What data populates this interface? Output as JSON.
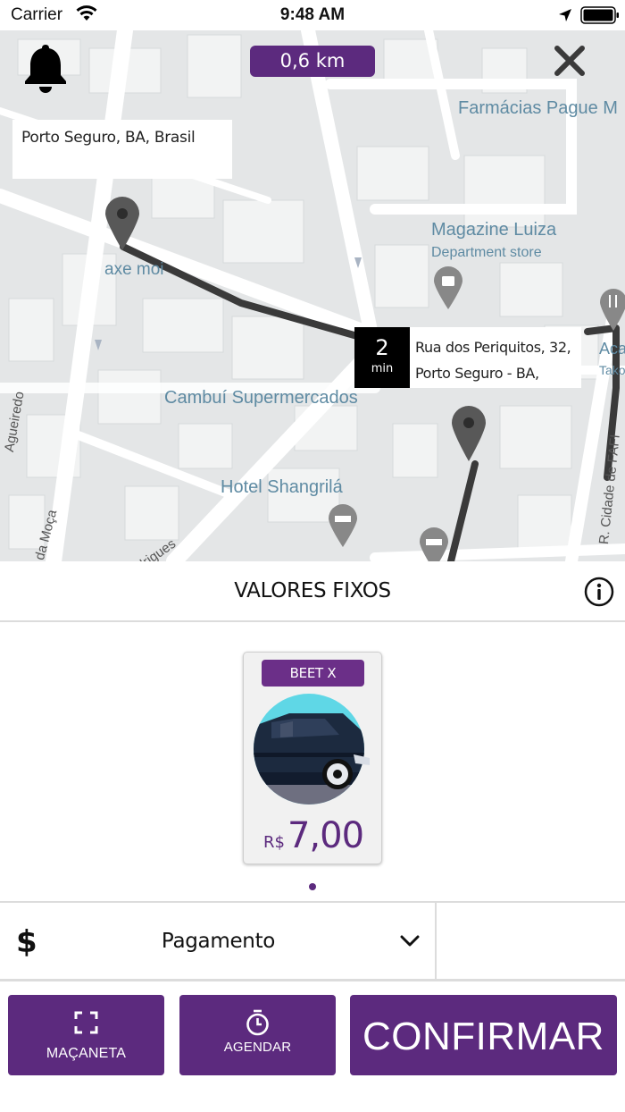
{
  "status_bar": {
    "carrier": "Carrier",
    "time": "9:48 AM",
    "icons": [
      "wifi-icon",
      "location-arrow-icon",
      "battery-icon"
    ]
  },
  "map": {
    "distance": "0,6 km",
    "origin_address": "Porto Seguro, BA, Brasil",
    "eta_value": "2",
    "eta_unit": "min",
    "destination_address_line1": "Rua dos Periquitos, 32,",
    "destination_address_line2": "Porto Seguro - BA,",
    "places": {
      "farmacias": "Farmácias Pague M",
      "magazine": "Magazine Luiza",
      "magazine_sub": "Department store",
      "axe_moi": "axe moi",
      "cambui": "Cambuí Supermercados",
      "hotel": "Hotel Shangrilá",
      "aca": "Aca",
      "tak": "Tako"
    },
    "streets": {
      "left_vertical": "Agueiredo",
      "bottom_moca": "da Moça",
      "bottom_rigues": "drigues",
      "right_vertical": "R. Cidade de FAFI"
    },
    "route_color": "#3a3a3a",
    "accent": "#5c2a7e"
  },
  "fixed_values": {
    "title": "VALORES FIXOS",
    "info_icon": "info-icon"
  },
  "vehicle": {
    "name": "BEET X",
    "currency": "R$",
    "price": "7,00",
    "image_icon": "car-icon"
  },
  "payment": {
    "icon": "dollar-icon",
    "label": "Pagamento"
  },
  "actions": {
    "macaneta": "MAÇANETA",
    "agendar": "AGENDAR",
    "confirmar": "CONFIRMAR"
  }
}
